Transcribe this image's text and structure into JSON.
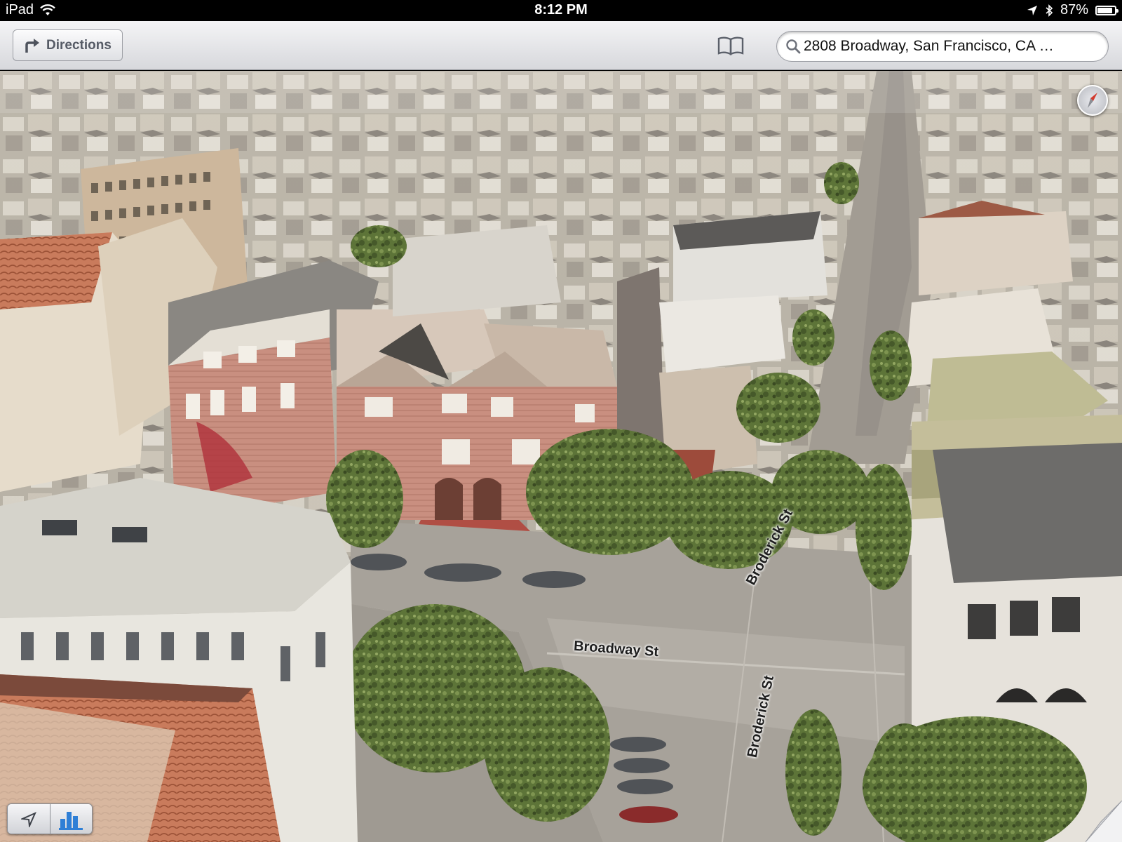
{
  "status_bar": {
    "device": "iPad",
    "time": "8:12 PM",
    "battery": "87%",
    "battery_level": 0.87
  },
  "toolbar": {
    "directions_label": "Directions",
    "search_value": "2808 Broadway, San Francisco, CA …"
  },
  "map": {
    "mode": "3D flyover",
    "road_labels": {
      "broadway": "Broadway St",
      "broderick_north": "Broderick St",
      "broderick_south": "Broderick St"
    }
  },
  "icons": {
    "directions": "turn-arrow-icon",
    "bookmarks": "book-icon",
    "search": "magnifier-icon",
    "compass": "compass-icon",
    "location": "location-arrow-icon",
    "three_d": "3d-buildings-icon",
    "page_curl": "page-curl-icon"
  }
}
